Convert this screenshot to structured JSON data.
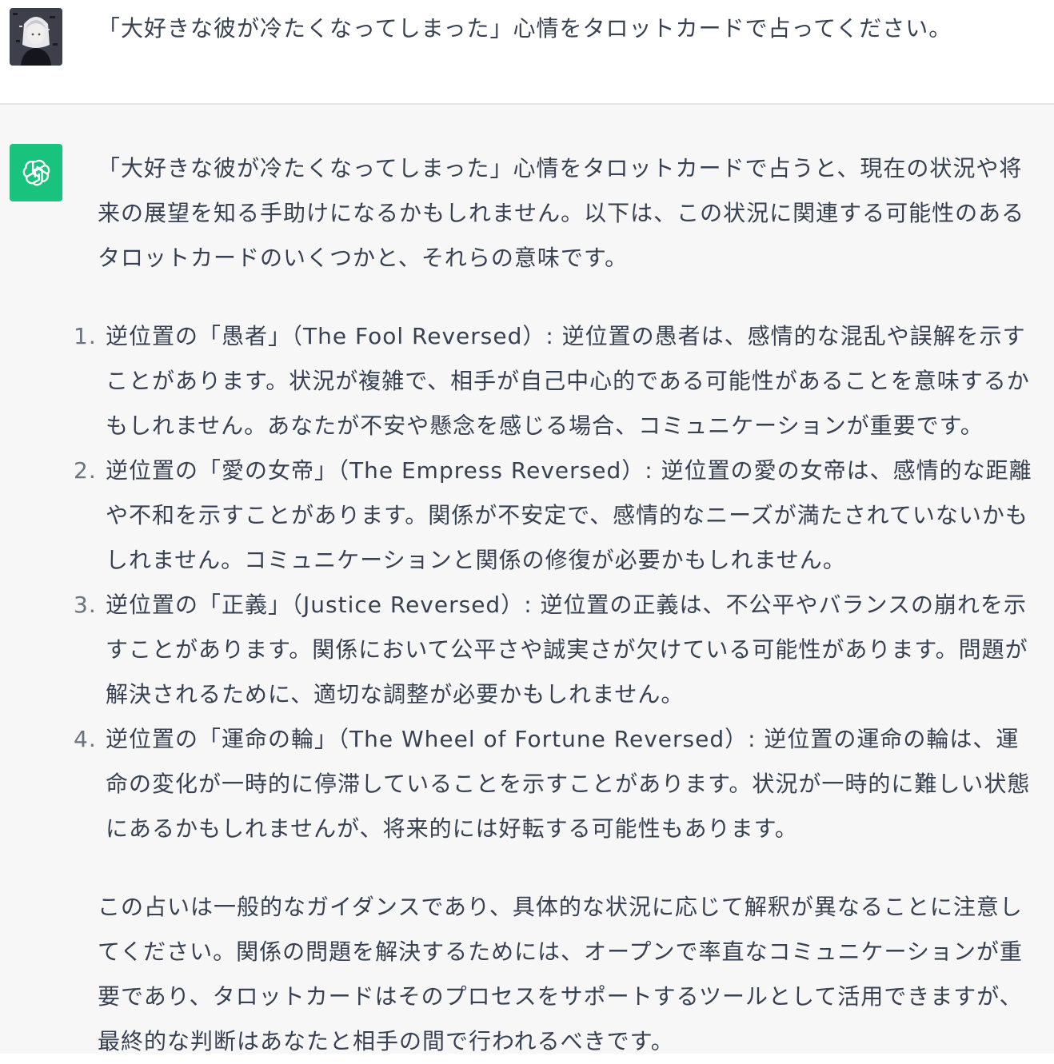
{
  "user_message": {
    "text": "「大好きな彼が冷たくなってしまった」心情をタロットカードで占ってください。"
  },
  "assistant_message": {
    "intro": "「大好きな彼が冷たくなってしまった」心情をタロットカードで占うと、現在の状況や将来の展望を知る手助けになるかもしれません。以下は、この状況に関連する可能性のあるタロットカードのいくつかと、それらの意味です。",
    "items": [
      {
        "number": "1.",
        "text": "逆位置の「愚者」（The Fool Reversed）: 逆位置の愚者は、感情的な混乱や誤解を示すことがあります。状況が複雑で、相手が自己中心的である可能性があることを意味するかもしれません。あなたが不安や懸念を感じる場合、コミュニケーションが重要です。"
      },
      {
        "number": "2.",
        "text": "逆位置の「愛の女帝」（The Empress Reversed）: 逆位置の愛の女帝は、感情的な距離や不和を示すことがあります。関係が不安定で、感情的なニーズが満たされていないかもしれません。コミュニケーションと関係の修復が必要かもしれません。"
      },
      {
        "number": "3.",
        "text": "逆位置の「正義」（Justice Reversed）: 逆位置の正義は、不公平やバランスの崩れを示すことがあります。関係において公平さや誠実さが欠けている可能性があります。問題が解決されるために、適切な調整が必要かもしれません。"
      },
      {
        "number": "4.",
        "text": "逆位置の「運命の輪」（The Wheel of Fortune Reversed）: 逆位置の運命の輪は、運命の変化が一時的に停滞していることを示すことがあります。状況が一時的に難しい状態にあるかもしれませんが、将来的には好転する可能性もあります。"
      }
    ],
    "closing": "この占いは一般的なガイダンスであり、具体的な状況に応じて解釈が異なることに注意してください。関係の問題を解決するためには、オープンで率直なコミュニケーションが重要であり、タロットカードはそのプロセスをサポートするツールとして活用できますが、最終的な判断はあなたと相手の間で行われるべきです。"
  },
  "colors": {
    "assistant_avatar_bg": "#19c37d",
    "assistant_row_bg": "#f7f7f8",
    "text": "#374151",
    "list_number": "#6b7280"
  },
  "icons": {
    "user_avatar": "user-avatar-image",
    "assistant_avatar": "openai-logo-icon"
  }
}
